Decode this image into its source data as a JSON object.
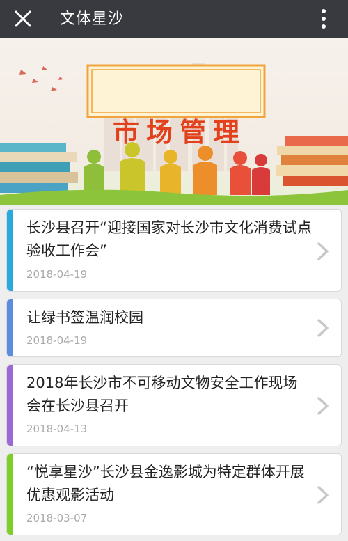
{
  "header": {
    "title": "文体星沙",
    "close_icon": "close-icon",
    "more_icon": "more-vertical-icon",
    "background": "#393a3f"
  },
  "banner": {
    "title": "市场管理",
    "title_color": "#e2411c",
    "frame_color": "#f1a43c"
  },
  "articles": [
    {
      "title": "长沙县召开“迎接国家对长沙市文化消费试点验收工作会”",
      "date": "2018-04-19",
      "accent": "#2aa8e0"
    },
    {
      "title": "让绿书签温润校园",
      "date": "2018-04-19",
      "accent": "#5b8ce0"
    },
    {
      "title": "2018年长沙市不可移动文物安全工作现场会在长沙县召开",
      "date": "2018-04-13",
      "accent": "#9b68d6"
    },
    {
      "title": "“悦享星沙”长沙县金逸影城为特定群体开展优惠观影活动",
      "date": "2018-03-07",
      "accent": "#7ccf26"
    }
  ]
}
